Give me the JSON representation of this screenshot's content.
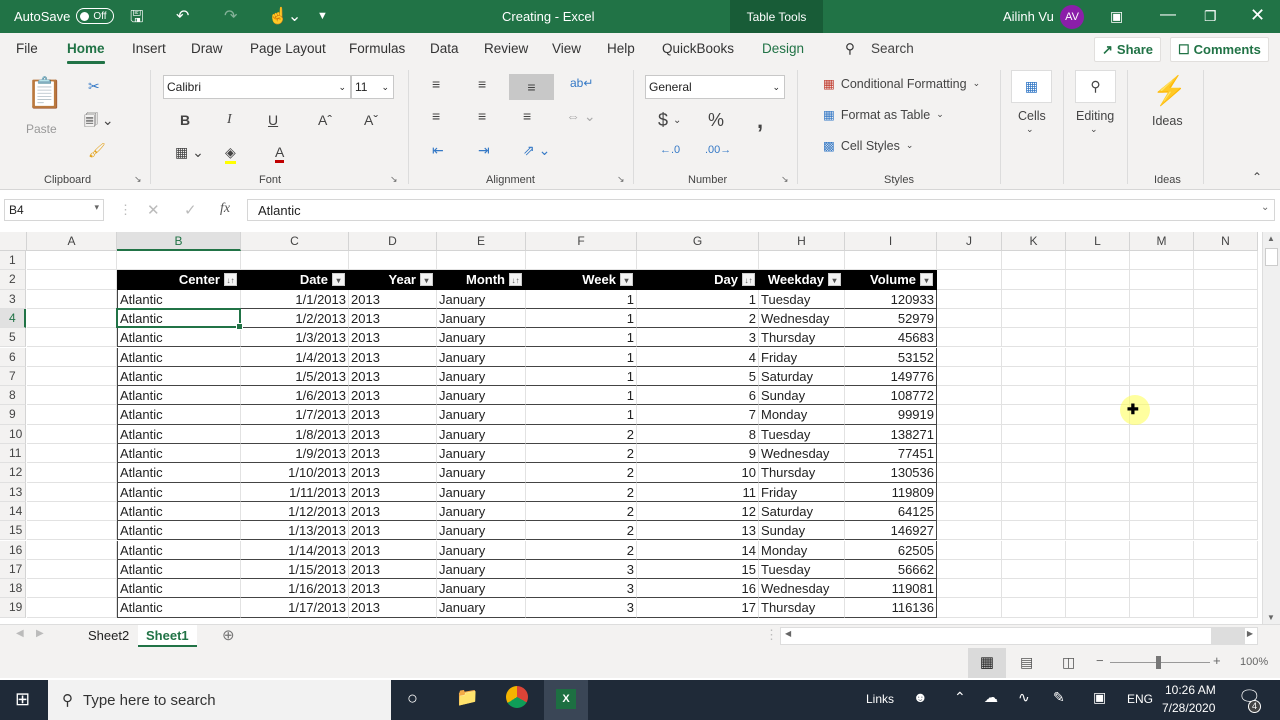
{
  "titlebar": {
    "autosave_label": "AutoSave",
    "autosave_state": "Off",
    "doc_title": "Creating  -  Excel",
    "context_tab": "Table Tools",
    "user_name": "Ailinh Vu",
    "user_initials": "AV"
  },
  "menu": {
    "items": [
      "File",
      "Home",
      "Insert",
      "Draw",
      "Page Layout",
      "Formulas",
      "Data",
      "Review",
      "View",
      "Help",
      "QuickBooks",
      "Design"
    ],
    "active": "Home",
    "search_placeholder": "Search",
    "share_label": "Share",
    "comments_label": "Comments"
  },
  "ribbon": {
    "clipboard": {
      "label": "Clipboard",
      "paste_label": "Paste"
    },
    "font": {
      "label": "Font",
      "font_name": "Calibri",
      "font_size": "11",
      "bold": "B",
      "italic": "I",
      "underline": "U"
    },
    "alignment": {
      "label": "Alignment"
    },
    "number": {
      "label": "Number",
      "format": "General",
      "currency": "$",
      "percent": "%",
      "comma": ","
    },
    "styles": {
      "label": "Styles",
      "conditional_formatting": "Conditional Formatting",
      "format_as_table": "Format as Table",
      "cell_styles": "Cell Styles"
    },
    "cells": {
      "label": "Cells"
    },
    "editing": {
      "label": "Editing"
    },
    "ideas": {
      "label": "Ideas",
      "group_label": "Ideas"
    }
  },
  "formula_bar": {
    "name_box": "B4",
    "formula": "Atlantic",
    "fx": "fx"
  },
  "sheet": {
    "columns": [
      "A",
      "B",
      "C",
      "D",
      "E",
      "F",
      "G",
      "H",
      "I",
      "J",
      "K",
      "L",
      "M",
      "N"
    ],
    "selected_column": "B",
    "selected_row": 4,
    "row_numbers": [
      "1",
      "2",
      "3",
      "4",
      "5",
      "6",
      "7",
      "8",
      "9",
      "10",
      "11",
      "12",
      "13",
      "14",
      "15",
      "16",
      "17",
      "18",
      "19"
    ],
    "table_headers": [
      "Center",
      "Date",
      "Year",
      "Month",
      "Week",
      "Day",
      "Weekday",
      "Volume"
    ],
    "rows": [
      [
        "Atlantic",
        "1/1/2013",
        "2013",
        "January",
        "1",
        "1",
        "Tuesday",
        "120933"
      ],
      [
        "Atlantic",
        "1/2/2013",
        "2013",
        "January",
        "1",
        "2",
        "Wednesday",
        "52979"
      ],
      [
        "Atlantic",
        "1/3/2013",
        "2013",
        "January",
        "1",
        "3",
        "Thursday",
        "45683"
      ],
      [
        "Atlantic",
        "1/4/2013",
        "2013",
        "January",
        "1",
        "4",
        "Friday",
        "53152"
      ],
      [
        "Atlantic",
        "1/5/2013",
        "2013",
        "January",
        "1",
        "5",
        "Saturday",
        "149776"
      ],
      [
        "Atlantic",
        "1/6/2013",
        "2013",
        "January",
        "1",
        "6",
        "Sunday",
        "108772"
      ],
      [
        "Atlantic",
        "1/7/2013",
        "2013",
        "January",
        "1",
        "7",
        "Monday",
        "99919"
      ],
      [
        "Atlantic",
        "1/8/2013",
        "2013",
        "January",
        "2",
        "8",
        "Tuesday",
        "138271"
      ],
      [
        "Atlantic",
        "1/9/2013",
        "2013",
        "January",
        "2",
        "9",
        "Wednesday",
        "77451"
      ],
      [
        "Atlantic",
        "1/10/2013",
        "2013",
        "January",
        "2",
        "10",
        "Thursday",
        "130536"
      ],
      [
        "Atlantic",
        "1/11/2013",
        "2013",
        "January",
        "2",
        "11",
        "Friday",
        "119809"
      ],
      [
        "Atlantic",
        "1/12/2013",
        "2013",
        "January",
        "2",
        "12",
        "Saturday",
        "64125"
      ],
      [
        "Atlantic",
        "1/13/2013",
        "2013",
        "January",
        "2",
        "13",
        "Sunday",
        "146927"
      ],
      [
        "Atlantic",
        "1/14/2013",
        "2013",
        "January",
        "2",
        "14",
        "Monday",
        "62505"
      ],
      [
        "Atlantic",
        "1/15/2013",
        "2013",
        "January",
        "3",
        "15",
        "Tuesday",
        "56662"
      ],
      [
        "Atlantic",
        "1/16/2013",
        "2013",
        "January",
        "3",
        "16",
        "Wednesday",
        "119081"
      ],
      [
        "Atlantic",
        "1/17/2013",
        "2013",
        "January",
        "3",
        "17",
        "Thursday",
        "116136"
      ]
    ]
  },
  "sheet_tabs": {
    "tabs": [
      "Sheet2",
      "Sheet1"
    ],
    "active": "Sheet1"
  },
  "status_bar": {
    "zoom": "100%",
    "zoom_minus": "−",
    "zoom_plus": "+"
  },
  "taskbar": {
    "search_placeholder": "Type here to search",
    "links_label": "Links",
    "language": "ENG",
    "time": "10:26 AM",
    "date": "7/28/2020",
    "notification_count": "4"
  },
  "colors": {
    "excel_green": "#217346",
    "avatar": "#8b1fa9",
    "taskbar": "#1f2a38"
  }
}
